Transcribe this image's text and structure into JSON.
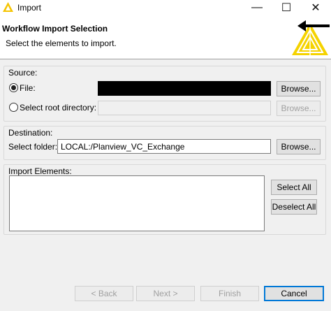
{
  "window": {
    "title": "Import",
    "minimize_symbol": "—",
    "maximize_symbol": "☐",
    "close_symbol": "✕"
  },
  "header": {
    "title": "Workflow Import Selection",
    "description": "Select the elements to import.",
    "logo_icon": "knime-import-logo"
  },
  "source": {
    "group_label": "Source:",
    "file_label": "File:",
    "file_selected": true,
    "file_value": "",
    "root_dir_label": "Select root directory:",
    "root_dir_value": "",
    "browse_label": "Browse...",
    "browse_disabled_label": "Browse..."
  },
  "destination": {
    "group_label": "Destination:",
    "folder_label": "Select folder:",
    "folder_value": "LOCAL:/Planview_VC_Exchange",
    "browse_label": "Browse..."
  },
  "import_elements": {
    "group_label": "Import Elements:",
    "items": [],
    "select_all_label": "Select All",
    "deselect_all_label": "Deselect All"
  },
  "footer": {
    "back_label": "< Back",
    "next_label": "Next >",
    "finish_label": "Finish",
    "cancel_label": "Cancel"
  },
  "colors": {
    "accent": "#0078d7",
    "logo_yellow": "#f5d300",
    "window_bg": "#f0f0f0"
  }
}
